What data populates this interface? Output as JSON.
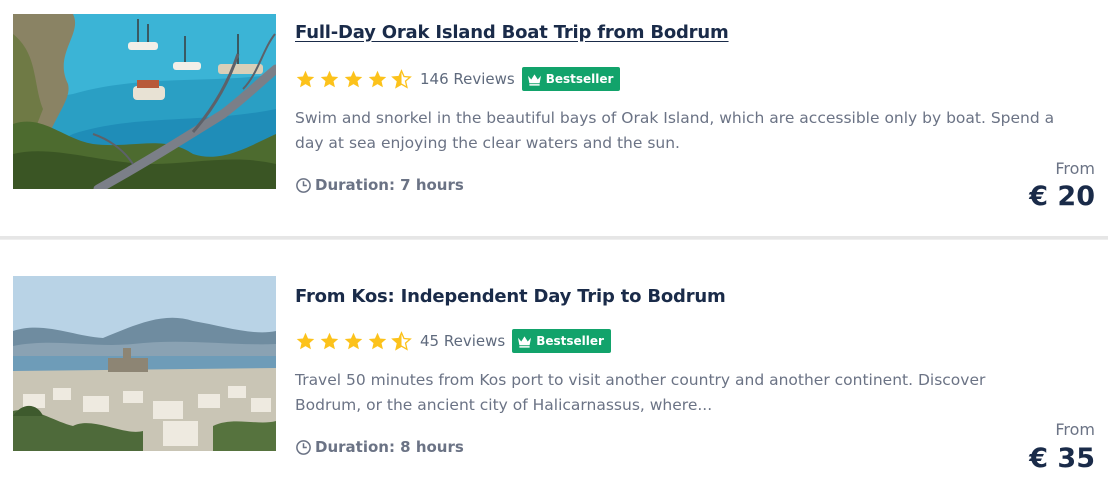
{
  "products": [
    {
      "title": "Full-Day Orak Island Boat Trip from Bodrum",
      "rating": 4.5,
      "reviews": "146 Reviews",
      "badge": "Bestseller",
      "description": "Swim and snorkel in the beautiful bays of Orak Island, which are accessible only by boat. Spend a day at sea enjoying the clear waters and the sun.",
      "duration": "Duration: 7 hours",
      "price_from": "From",
      "price": "€ 20",
      "image": "orak-island-boats-photo"
    },
    {
      "title": "From Kos: Independent Day Trip to Bodrum",
      "rating": 4.5,
      "reviews": "45 Reviews",
      "badge": "Bestseller",
      "description": "Travel 50 minutes from Kos port to visit another country and another continent. Discover Bodrum, or the ancient city of Halicarnassus, where...",
      "duration": "Duration: 8 hours",
      "price_from": "From",
      "price": "€ 35",
      "image": "bodrum-town-photo"
    }
  ],
  "colors": {
    "star": "#fcc21b",
    "badge": "#12a36b",
    "title": "#1a2b49",
    "text": "#6b7385"
  },
  "icons": [
    "star-icon",
    "crown-icon",
    "clock-icon"
  ]
}
